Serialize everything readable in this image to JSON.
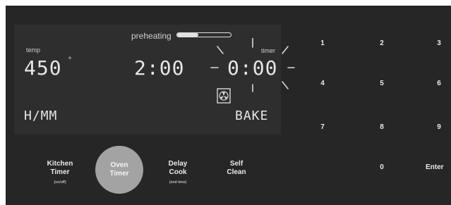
{
  "display": {
    "preheating_label": "preheating",
    "preheating_progress": 0.4,
    "temp_label": "temp",
    "temp_value": "450",
    "degree_symbol": "°",
    "clock_time": "2:00",
    "timer_label": "timer",
    "timer_value": "0:00",
    "mode_left": "H/MM",
    "mode_right": "BAKE"
  },
  "keypad": {
    "keys": [
      "1",
      "2",
      "3",
      "4",
      "5",
      "6",
      "7",
      "8",
      "9",
      "0",
      "Enter"
    ]
  },
  "buttons": {
    "kitchen_timer": {
      "line1": "Kitchen",
      "line2": "Timer",
      "sub": "(on/off)"
    },
    "oven_timer": {
      "line1": "Oven",
      "line2": "Timer"
    },
    "delay_cook": {
      "line1": "Delay",
      "line2": "Cook",
      "sub": "(end time)"
    },
    "self_clean": {
      "line1": "Self",
      "line2": "Clean"
    }
  },
  "colors": {
    "panel": "#262626",
    "display": "#2e2e2e",
    "segment": "#e6e6e6",
    "active_button": "#a3a3a3"
  },
  "icons": {
    "oven_fan": "convection-fan-icon"
  }
}
